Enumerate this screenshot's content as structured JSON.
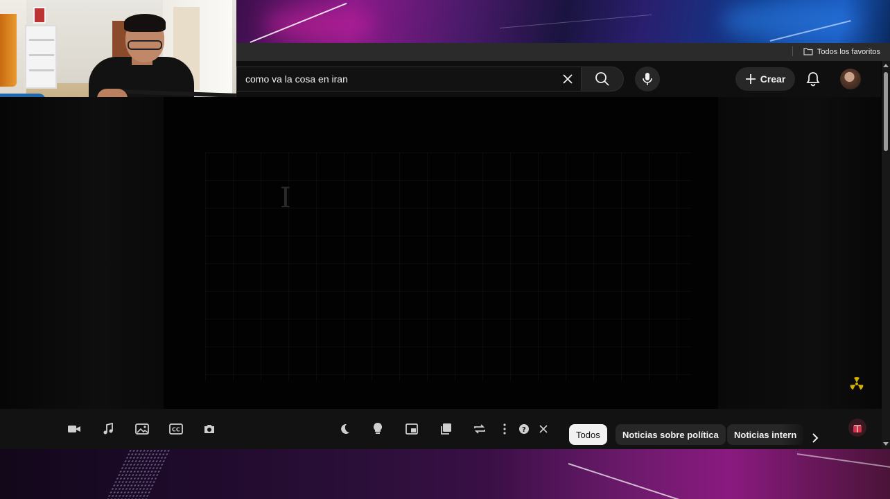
{
  "browser": {
    "bookmarks_bar": {
      "all_bookmarks_label": "Todos los favoritos",
      "folder_icon": "folder-icon"
    }
  },
  "masthead": {
    "search": {
      "value": "como va la cosa en iran",
      "clear_icon": "close-icon",
      "search_icon": "search-icon"
    },
    "voice_search_icon": "mic-icon",
    "create_label": "Crear",
    "create_icon": "plus-icon",
    "notifications_icon": "bell-icon",
    "avatar_icon": "avatar"
  },
  "player_toolbar": {
    "tools": [
      {
        "icon": "video-camera-icon"
      },
      {
        "icon": "music-note-icon"
      },
      {
        "icon": "image-icon"
      },
      {
        "icon": "closed-captions-icon"
      },
      {
        "icon": "camera-icon"
      },
      {
        "icon": "moon-icon"
      },
      {
        "icon": "lightbulb-icon"
      },
      {
        "icon": "picture-in-picture-icon"
      },
      {
        "icon": "copy-icon"
      },
      {
        "icon": "repeat-icon"
      },
      {
        "icon": "more-vertical-icon"
      },
      {
        "icon": "help-icon"
      },
      {
        "icon": "close-icon"
      }
    ]
  },
  "filter_chips": {
    "items": [
      {
        "label": "Todos",
        "active": true
      },
      {
        "label": "Noticias sobre política",
        "active": false
      },
      {
        "label": "Noticias intern",
        "active": false
      }
    ],
    "next_icon": "chevron-right-icon"
  },
  "colors": {
    "background": "#0f0f0f",
    "chip_active": "#f1f1f1",
    "chip_inactive": "#272727",
    "hazard_icon": "#d4b000"
  }
}
